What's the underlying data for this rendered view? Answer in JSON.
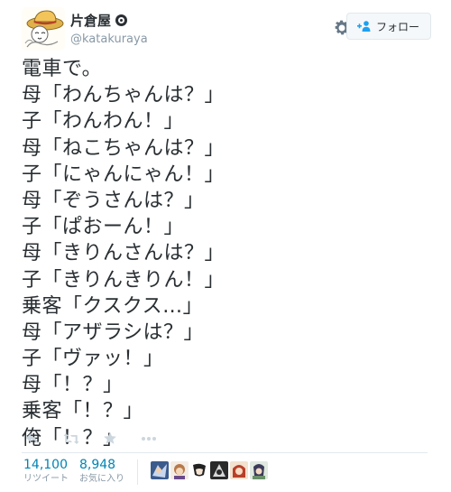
{
  "user": {
    "display_name": "片倉屋",
    "handle": "@katakuraya",
    "avatar_icon": "avatar-straw-hat"
  },
  "header": {
    "settings_icon": "gear-icon",
    "follow_label": "フォロー",
    "follow_icon": "add-user-icon"
  },
  "tweet": {
    "lines": [
      "電車で。",
      "母「わんちゃんは？」",
      "子「わんわん！」",
      "母「ねこちゃんは？」",
      "子「にゃんにゃん！」",
      "母「ぞうさんは？」",
      "子「ぱおーん！」",
      "母「きりんさんは？」",
      "子「きりんきりん！」",
      "乗客「クスクス…」",
      "母「アザラシは？」",
      "子「ヴァッ！」",
      "母「！？」",
      "乗客「！？」",
      "俺「！？」"
    ]
  },
  "actions": {
    "reply_icon": "reply-icon",
    "retweet_icon": "retweet-icon",
    "favorite_icon": "star-icon",
    "more_icon": "more-icon"
  },
  "stats": {
    "retweets_count": "14,100",
    "retweets_label": "リツイート",
    "favorites_count": "8,948",
    "favorites_label": "お気に入り"
  },
  "likers": [
    {
      "icon": "liker-avatar-1",
      "color": "#3b5b8c"
    },
    {
      "icon": "liker-avatar-2",
      "color": "#b87a4a"
    },
    {
      "icon": "liker-avatar-3",
      "color": "#d8d8d8"
    },
    {
      "icon": "liker-avatar-4",
      "color": "#2a2a2a"
    },
    {
      "icon": "liker-avatar-5",
      "color": "#b8402a"
    },
    {
      "icon": "liker-avatar-6",
      "color": "#6a8f6a"
    }
  ],
  "colors": {
    "text": "#292f33",
    "muted": "#8899a6",
    "link": "#0084b4",
    "icon": "#ccd6dd",
    "border": "#e1e8ed"
  }
}
